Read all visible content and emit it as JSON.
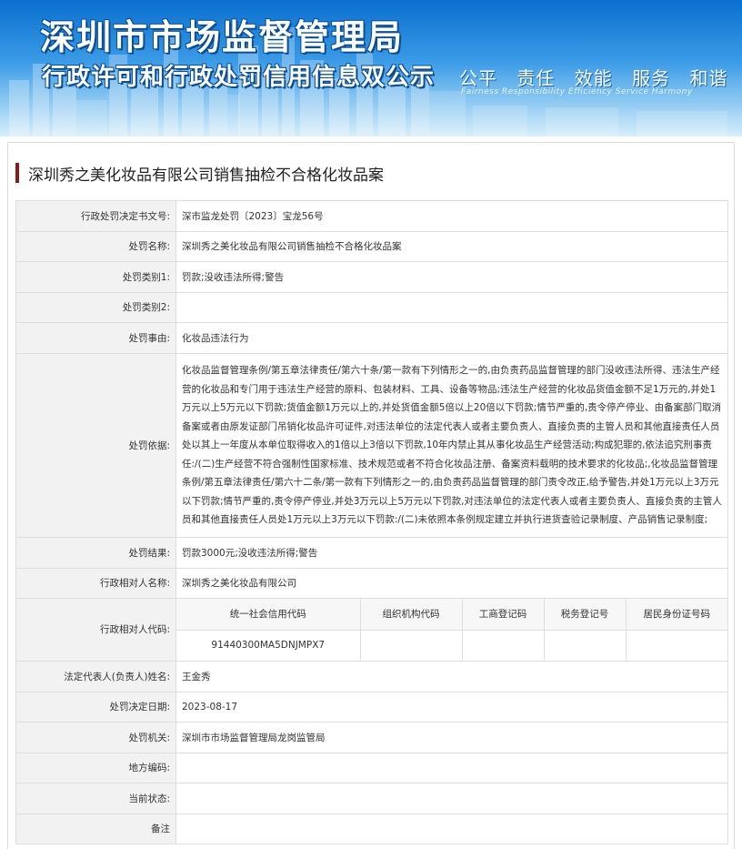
{
  "banner": {
    "title_main": "深圳市市场监督管理局",
    "title_sub": "行政许可和行政处罚信用信息双公示",
    "values": [
      "公平",
      "责任",
      "效能",
      "服务",
      "和谐"
    ],
    "values_en": "Fairness  Responsibility  Efficiency  Service  Harmony"
  },
  "page_title": "深圳秀之美化妆品有限公司销售抽检不合格化妆品案",
  "fields": {
    "decision_no": {
      "label": "行政处罚决定书文号:",
      "value": "深市监龙处罚〔2023〕宝龙56号"
    },
    "case_name": {
      "label": "处罚名称:",
      "value": "深圳秀之美化妆品有限公司销售抽检不合格化妆品案"
    },
    "category1": {
      "label": "处罚类别1:",
      "value": "罚款;没收违法所得;警告"
    },
    "category2": {
      "label": "处罚类别2:",
      "value": ""
    },
    "reason": {
      "label": "处罚事由:",
      "value": "化妆品违法行为"
    },
    "basis": {
      "label": "处罚依据:",
      "value": "化妆品监督管理条例/第五章法律责任/第六十条/第一款有下列情形之一的,由负责药品监督管理的部门没收违法所得、违法生产经营的化妆品和专门用于违法生产经营的原料、包装材料、工具、设备等物品;违法生产经营的化妆品货值金额不足1万元的,并处1万元以上5万元以下罚款;货值金额1万元以上的,并处货值金额5倍以上20倍以下罚款;情节严重的,责令停产停业、由备案部门取消备案或者由原发证部门吊销化妆品许可证件,对违法单位的法定代表人或者主要负责人、直接负责的主管人员和其他直接责任人员处以其上一年度从本单位取得收入的1倍以上3倍以下罚款,10年内禁止其从事化妆品生产经营活动;构成犯罪的,依法追究刑事责任:/(二)生产经营不符合强制性国家标准、技术规范或者不符合化妆品注册、备案资料载明的技术要求的化妆品;,化妆品监督管理条例/第五章法律责任/第六十二条/第一款有下列情形之一的,由负责药品监督管理的部门责令改正,给予警告,并处1万元以上3万元以下罚款;情节严重的,责令停产停业,并处3万元以上5万元以下罚款,对违法单位的法定代表人或者主要负责人、直接负责的主管人员和其他直接责任人员处1万元以上3万元以下罚款:/(二)未依照本条例规定建立并执行进货查验记录制度、产品销售记录制度;"
    },
    "result": {
      "label": "处罚结果:",
      "value": "罚款3000元;没收违法所得;警告"
    },
    "party_name": {
      "label": "行政相对人名称:",
      "value": "深圳秀之美化妆品有限公司"
    },
    "party_code": {
      "label": "行政相对人代码:"
    },
    "legal_rep": {
      "label": "法定代表人(负责人)姓名:",
      "value": "王金秀"
    },
    "decision_date": {
      "label": "处罚决定日期:",
      "value": "2023-08-17"
    },
    "authority": {
      "label": "处罚机关:",
      "value": "深圳市市场监督管理局龙岗监管局"
    },
    "region_code": {
      "label": "地方编码:",
      "value": ""
    },
    "current_status": {
      "label": "当前状态:",
      "value": ""
    },
    "remarks": {
      "label": "备注",
      "value": ""
    }
  },
  "code_table": {
    "headers": [
      "统一社会信用代码",
      "组织机构代码",
      "工商登记码",
      "税务登记号",
      "居民身份证号码"
    ],
    "values": [
      "91440300MA5DNJMPX7",
      "",
      "",
      "",
      ""
    ]
  }
}
